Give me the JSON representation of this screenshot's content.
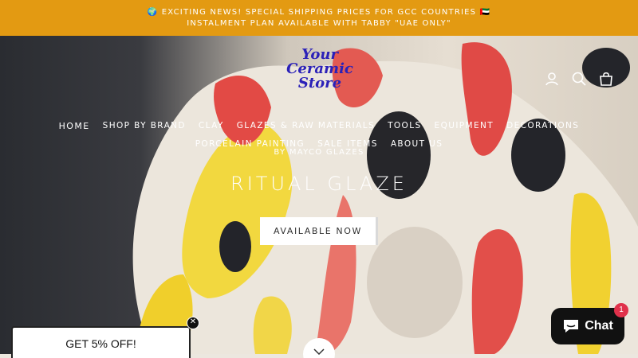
{
  "announcement": {
    "line1": "🌍 EXCITING NEWS! SPECIAL SHIPPING PRICES FOR GCC COUNTRIES 🇦🇪",
    "line2": "INSTALMENT PLAN AVAILABLE WITH TABBY \"UAE ONLY\""
  },
  "logo": {
    "line1": "Your",
    "line2": "Ceramic",
    "line3": "Store"
  },
  "header_icons": [
    "account-icon",
    "search-icon",
    "cart-icon"
  ],
  "nav": {
    "row1": [
      "HOME",
      "SHOP BY BRAND",
      "CLAY",
      "GLAZES & RAW MATERIALS",
      "TOOLS",
      "EQUIPMENT",
      "DECORATIONS"
    ],
    "row2": [
      "PORCELAIN PAINTING",
      "SALE ITEMS",
      "ABOUT US"
    ]
  },
  "hero": {
    "subtitle": "BY MAYCO GLAZES",
    "title": "RITUAL GLAZE",
    "cta": "AVAILABLE NOW"
  },
  "promo": {
    "label": "GET 5% OFF!",
    "close": "✕"
  },
  "chat": {
    "label": "Chat",
    "badge": "1"
  },
  "colors": {
    "announcement_bg": "#e39a12",
    "logo": "#2b21b8",
    "chat_badge": "#e0314b"
  }
}
